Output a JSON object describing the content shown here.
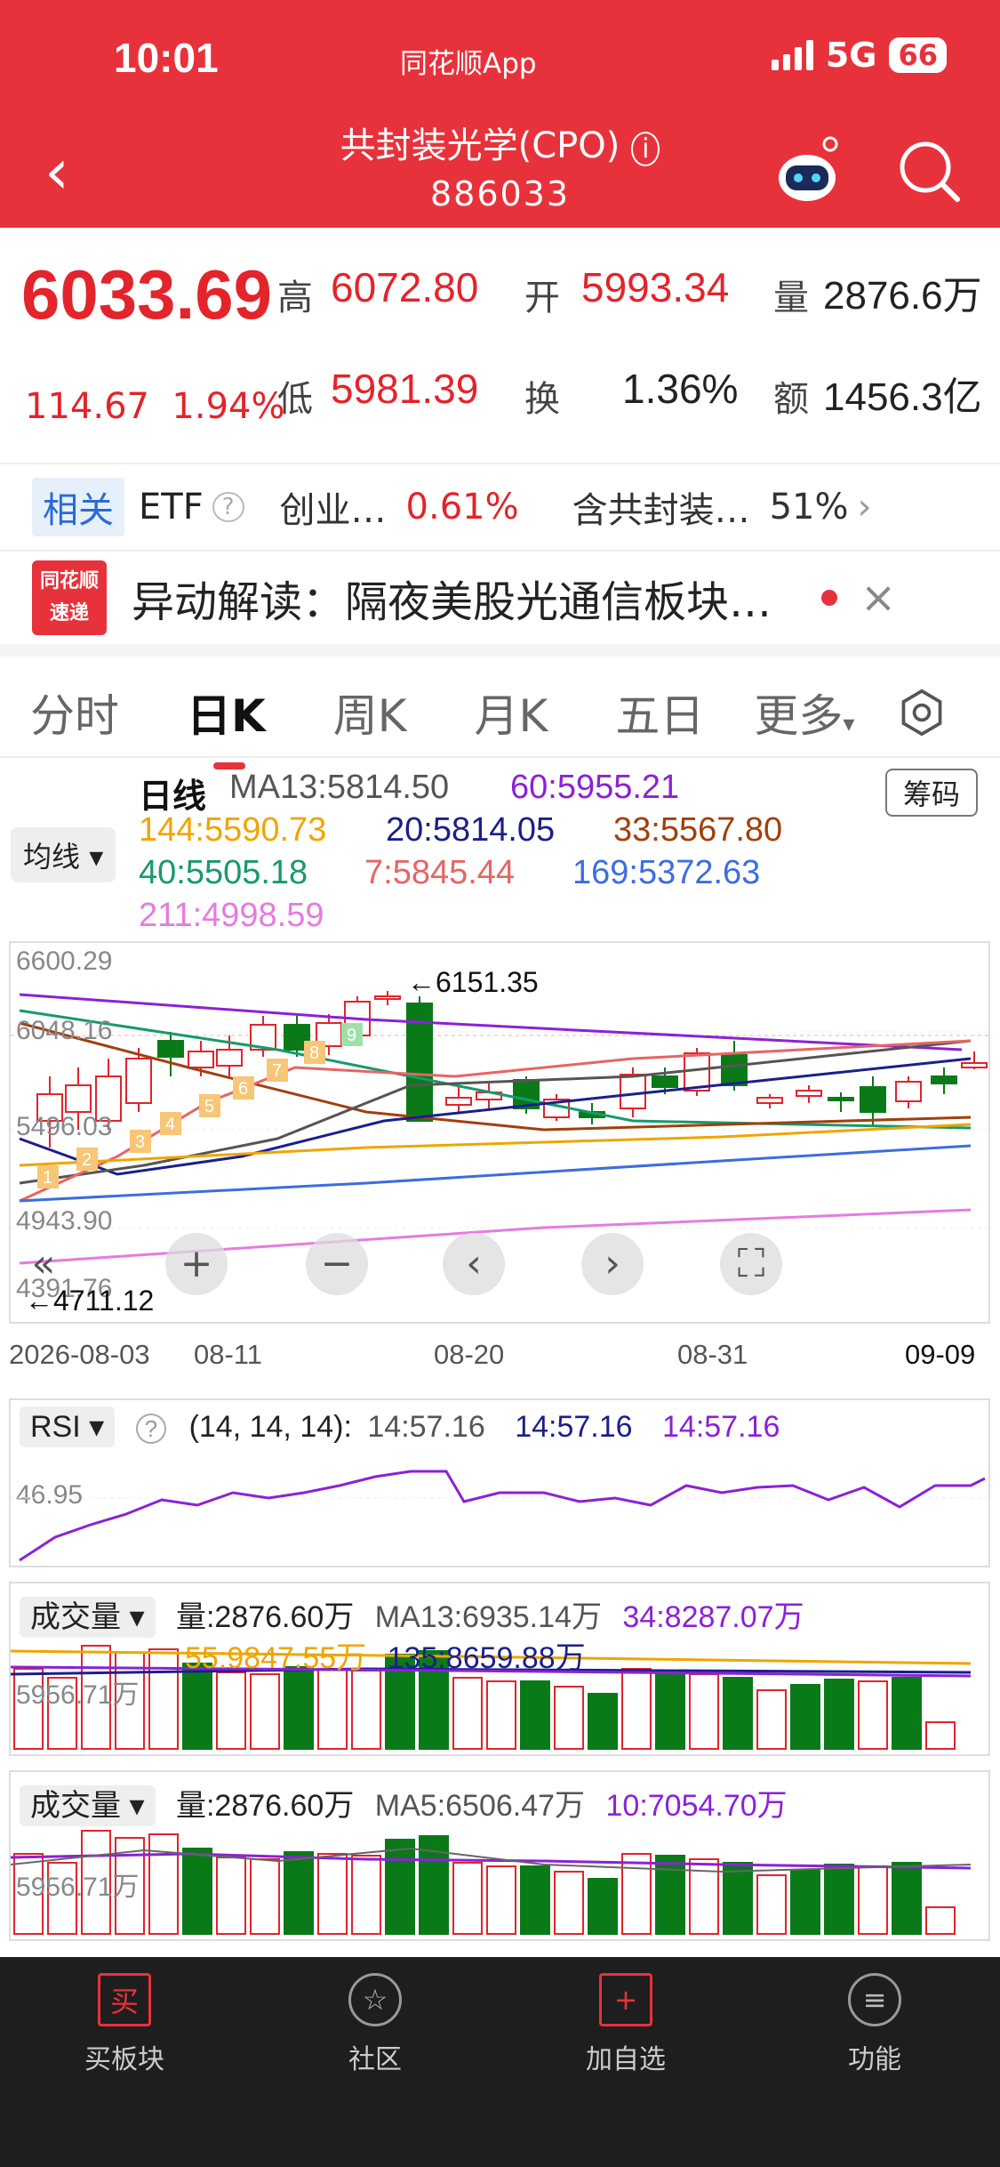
{
  "status": {
    "time": "10:01",
    "app": "同花顺App",
    "network": "5G",
    "battery": "66"
  },
  "nav": {
    "title": "共封装光学(CPO)",
    "code": "886033",
    "info_icon": "info-icon",
    "robot_icon": "robot-icon",
    "search_icon": "search-icon"
  },
  "quote": {
    "price": "6033.69",
    "change": "114.67",
    "pct": "1.94%",
    "high_l": "高",
    "high": "6072.80",
    "open_l": "开",
    "open": "5993.34",
    "vol_l": "量",
    "vol": "2876.6万",
    "low_l": "低",
    "low": "5981.39",
    "turn_l": "换",
    "turn": "1.36%",
    "amt_l": "额",
    "amt": "1456.3亿"
  },
  "etf": {
    "tag": "相关",
    "label": "ETF",
    "name1": "创业…",
    "pct1": "0.61%",
    "name2": "含共封装…",
    "pct2": "51%"
  },
  "news": {
    "logo1": "同花顺",
    "logo2": "速递",
    "text": "异动解读：隔夜美股光通信板块…"
  },
  "tabs": [
    {
      "label": "分时"
    },
    {
      "label": "日K"
    },
    {
      "label": "周K"
    },
    {
      "label": "月K"
    },
    {
      "label": "五日"
    },
    {
      "label": "更多"
    }
  ],
  "ma": {
    "daily": "日线",
    "ma13": "MA13:5814.50",
    "m60": "60:5955.21",
    "m144": "144:5590.73",
    "m20": "20:5814.05",
    "m33": "33:5567.80",
    "m40": "40:5505.18",
    "m7": "7:5845.44",
    "m169": "169:5372.63",
    "m211": "211:4998.59",
    "chip": "筹码",
    "junxian": "均线"
  },
  "kchart": {
    "y_top": "6600.29",
    "y2": "6048.16",
    "y3": "5496.03",
    "y4": "4943.90",
    "y5": "4391.76",
    "hi_mark": "←6151.35",
    "lo_mark": "←4711.12",
    "dates": [
      "2026-08-03",
      "08-11",
      "08-20",
      "08-31",
      "09-09"
    ],
    "td_labels": [
      "1",
      "2",
      "3",
      "4",
      "5",
      "6",
      "7",
      "8",
      "9"
    ]
  },
  "rsi": {
    "name": "RSI",
    "params": "(14, 14, 14):",
    "v1": "14:57.16",
    "v2": "14:57.16",
    "v3": "14:57.16",
    "level": "46.95"
  },
  "vol1": {
    "name": "成交量",
    "v": "量:2876.60万",
    "ma13": "MA13:6935.14万",
    "m34": "34:8287.07万",
    "m55": "55:9847.55万",
    "m135": "135:8659.88万",
    "level": "5956.71万"
  },
  "vol2": {
    "name": "成交量",
    "v": "量:2876.60万",
    "ma5": "MA5:6506.47万",
    "m10": "10:7054.70万",
    "level": "5956.71万"
  },
  "bottom": {
    "b1": "买板块",
    "b1i": "买",
    "b2": "社区",
    "b3": "加自选",
    "b4": "功能"
  },
  "colors": {
    "up": "#e3242b",
    "down": "#0a7a19",
    "header": "#e8323b"
  }
}
